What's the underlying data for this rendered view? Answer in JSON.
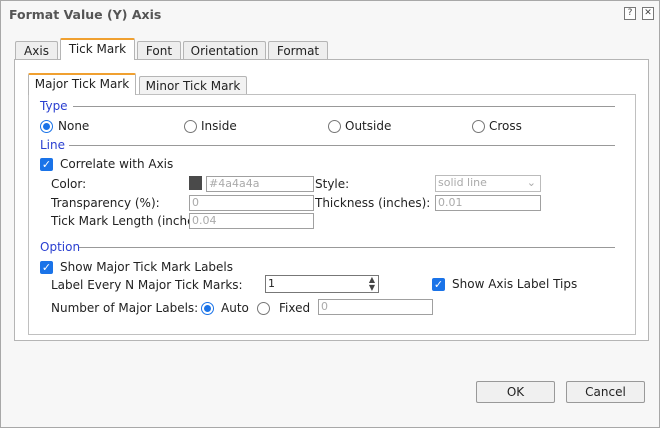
{
  "dialog": {
    "title": "Format Value (Y) Axis",
    "help_icon": "question-icon",
    "close_icon": "close-icon"
  },
  "tabs": [
    "Axis",
    "Tick Mark",
    "Font",
    "Orientation",
    "Format"
  ],
  "active_tab": "Tick Mark",
  "subtabs": [
    "Major Tick Mark",
    "Minor Tick Mark"
  ],
  "active_subtab": "Major Tick Mark",
  "type": {
    "label": "Type",
    "options": [
      "None",
      "Inside",
      "Outside",
      "Cross"
    ],
    "selected": "None"
  },
  "line": {
    "label": "Line",
    "correlate": "Correlate with Axis",
    "correlate_checked": true,
    "color_label": "Color:",
    "color_value": "#4a4a4a",
    "swatch": "#4a4a4a",
    "style_label": "Style:",
    "style_value": "solid line",
    "transparency_label": "Transparency (%):",
    "transparency_value": "0",
    "thickness_label": "Thickness (inches):",
    "thickness_value": "0.01",
    "length_label": "Tick Mark Length (inches):",
    "length_value": "0.04"
  },
  "option": {
    "label": "Option",
    "show_labels": "Show Major Tick Mark Labels",
    "show_labels_checked": true,
    "every_n_label": "Label Every N Major Tick Marks:",
    "every_n_value": "1",
    "tips": "Show Axis Label Tips",
    "tips_checked": true,
    "num_labels": "Number of Major Labels:",
    "auto": "Auto",
    "fixed": "Fixed",
    "num_mode": "Auto",
    "fixed_value": "0"
  },
  "buttons": {
    "ok": "OK",
    "cancel": "Cancel"
  }
}
